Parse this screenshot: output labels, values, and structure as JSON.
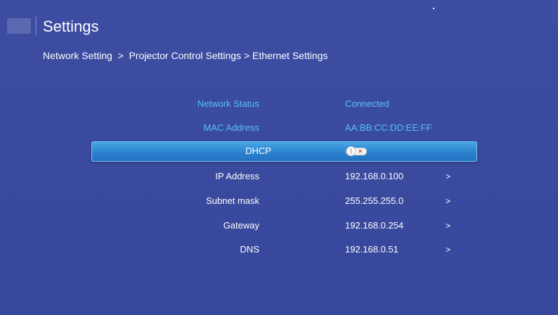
{
  "header": {
    "title": "Settings",
    "breadcrumb": "Network Setting  >  Projector Control Settings > Ethernet Settings"
  },
  "rows": {
    "network_status": {
      "label": "Network Status",
      "value": "Connected"
    },
    "mac_address": {
      "label": "MAC Address",
      "value": "AA:BB:CC:DD:EE:FF"
    },
    "dhcp": {
      "label": "DHCP",
      "toggle_state": "off",
      "toggle_off_glyph": "×"
    },
    "ip_address": {
      "label": "IP Address",
      "value": "192.168.0.100",
      "arrow": ">"
    },
    "subnet_mask": {
      "label": "Subnet mask",
      "value": "255.255.255.0",
      "arrow": ">"
    },
    "gateway": {
      "label": "Gateway",
      "value": "192.168.0.254",
      "arrow": ">"
    },
    "dns": {
      "label": "DNS",
      "value": "192.168.0.51",
      "arrow": ">"
    }
  },
  "colors": {
    "background": "#3a4a9c",
    "info_text": "#58c3ee",
    "highlight": "#2b82cf",
    "text": "#ffffff"
  }
}
